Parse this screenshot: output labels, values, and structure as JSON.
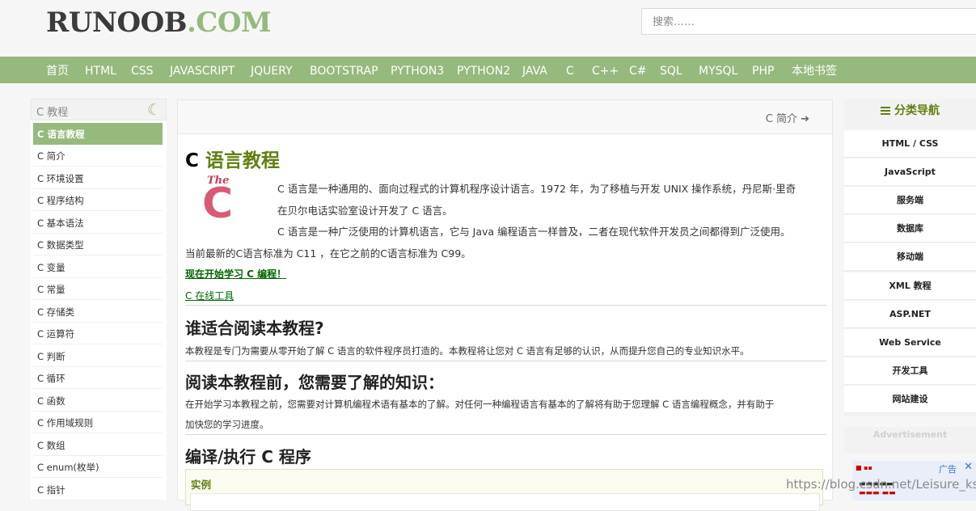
{
  "header": {
    "logo_part1": "RUNOOB",
    "logo_part2": ".COM",
    "search_placeholder": "搜索……"
  },
  "nav": [
    "首页",
    "HTML",
    "CSS",
    "JAVASCRIPT",
    "JQUERY",
    "BOOTSTRAP",
    "PYTHON3",
    "PYTHON2",
    "JAVA",
    "C",
    "C++",
    "C#",
    "SQL",
    "MYSQL",
    "PHP",
    "本地书签"
  ],
  "sidebar": {
    "title": "C 教程",
    "items": [
      "C 语言教程",
      "C 简介",
      "C 环境设置",
      "C 程序结构",
      "C 基本语法",
      "C 数据类型",
      "C 变量",
      "C 常量",
      "C 存储类",
      "C 运算符",
      "C 判断",
      "C 循环",
      "C 函数",
      "C 作用域规则",
      "C 数组",
      "C enum(枚举)",
      "C 指针"
    ],
    "active_index": 0
  },
  "main": {
    "next_link": "C 简介",
    "title_part1": "C ",
    "title_part2": "语言教程",
    "logo_the": "The",
    "logo_c": "C",
    "intro_line1": "C 语言是一种通用的、面向过程式的计算机程序设计语言。1972 年，为了移植与开发 UNIX 操作系统，丹尼斯·里奇",
    "intro_line2": "在贝尔电话实验室设计开发了 C 语言。",
    "intro_line3": "C 语言是一种广泛使用的计算机语言，它与 Java 编程语言一样普及，二者在现代软件开发员之间都得到广泛使用。",
    "intro_line4": "当前最新的C语言标准为 C11 ，在它之前的C语言标准为 C99。",
    "start_link": "现在开始学习 C 编程！",
    "online_tool_link": "C 在线工具",
    "h2_audience": "谁适合阅读本教程?",
    "audience_text": "本教程是专门为需要从零开始了解 C 语言的软件程序员打造的。本教程将让您对 C 语言有足够的认识，从而提升您自己的专业知识水平。",
    "h2_prereq": "阅读本教程前，您需要了解的知识：",
    "prereq_line1": "在开始学习本教程之前，您需要对计算机编程术语有基本的了解。对任何一种编程语言有基本的了解将有助于您理解 C 语言编程概念，并有助于",
    "prereq_line2": "加快您的学习进度。",
    "h2_compile": "编译/执行 C 程序",
    "example_label": "实例"
  },
  "right": {
    "title": "分类导航",
    "items": [
      "HTML / CSS",
      "JavaScript",
      "服务端",
      "数据库",
      "移动端",
      "XML 教程",
      "ASP.NET",
      "Web Service",
      "开发工具",
      "网站建设"
    ],
    "advertisement": "Advertisement",
    "ad_tag": "广告",
    "ad_close": "✕"
  },
  "watermark": "https://blog.csdn.net/Leisure_ksj",
  "colors": {
    "brand_green": "#96b97d",
    "link_green": "#006600",
    "title_green": "#617f10"
  }
}
